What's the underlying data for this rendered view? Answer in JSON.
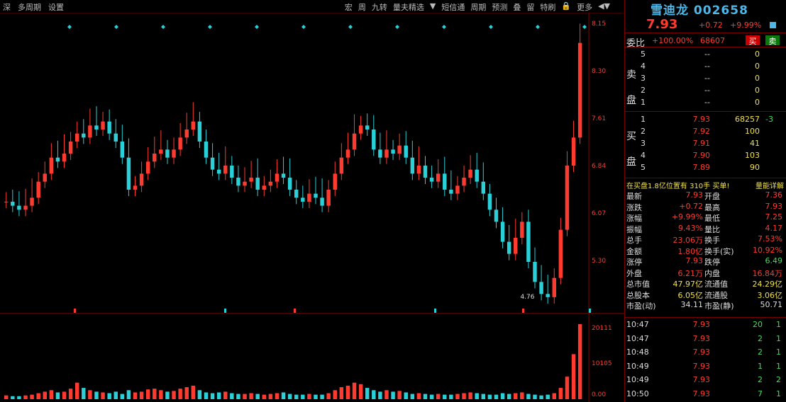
{
  "toolbar": {
    "left": [
      "深",
      "多周期",
      "设置"
    ],
    "right": [
      "宏",
      "周",
      "九转",
      "量夫精选",
      "▼",
      "短信通",
      "周期",
      "预测",
      "叠",
      "留",
      "特刷",
      "🔒",
      "更多",
      "◀▼"
    ]
  },
  "chart_data": {
    "type": "line",
    "price_axis_ticks": [
      "8.15",
      "8.30",
      "7.61",
      "6.84",
      "6.07",
      "5.30"
    ],
    "volume_axis_ticks": [
      "20111",
      "10105",
      "0.00"
    ],
    "low_annotation": "4.76",
    "ylim": [
      4.6,
      8.2
    ],
    "closes": [
      5.95,
      5.9,
      5.85,
      5.9,
      6.0,
      6.2,
      6.3,
      6.5,
      6.45,
      6.55,
      6.7,
      6.8,
      6.75,
      6.9,
      6.85,
      6.95,
      6.8,
      6.7,
      6.5,
      6.1,
      6.15,
      6.3,
      6.45,
      6.55,
      6.6,
      6.5,
      6.6,
      6.75,
      6.85,
      6.95,
      6.7,
      6.5,
      6.35,
      6.3,
      6.4,
      6.25,
      6.15,
      6.2,
      6.25,
      6.1,
      6.15,
      6.2,
      6.3,
      6.25,
      6.1,
      6.0,
      5.95,
      6.05,
      6.0,
      5.9,
      6.1,
      6.3,
      6.5,
      6.6,
      6.8,
      6.9,
      6.85,
      6.6,
      6.5,
      6.6,
      6.55,
      6.65,
      6.5,
      6.3,
      6.4,
      6.25,
      6.2,
      6.3,
      6.1,
      6.05,
      6.15,
      6.25,
      6.35,
      6.2,
      6.05,
      5.85,
      5.7,
      5.45,
      5.3,
      5.5,
      5.7,
      5.2,
      4.95,
      4.8,
      4.76,
      5.0,
      5.6,
      6.4,
      6.75,
      7.93
    ],
    "volume": [
      5,
      4,
      4,
      5,
      6,
      8,
      10,
      12,
      9,
      10,
      14,
      22,
      15,
      12,
      10,
      9,
      8,
      10,
      7,
      12,
      9,
      10,
      13,
      14,
      12,
      10,
      11,
      14,
      16,
      18,
      12,
      9,
      8,
      9,
      10,
      8,
      7,
      7,
      8,
      7,
      6,
      7,
      8,
      9,
      7,
      6,
      6,
      7,
      6,
      6,
      8,
      12,
      16,
      18,
      22,
      20,
      15,
      12,
      10,
      12,
      10,
      11,
      9,
      7,
      8,
      7,
      6,
      7,
      6,
      6,
      7,
      8,
      9,
      8,
      7,
      6,
      6,
      8,
      7,
      8,
      9,
      7,
      6,
      5,
      6,
      8,
      15,
      30,
      60,
      100
    ],
    "signal_markers_count": 12
  },
  "stock": {
    "name": "雪迪龙",
    "code": "002658",
    "price": "7.93",
    "change": "+0.72",
    "change_pct": "+9.99%"
  },
  "ratio": {
    "label": "委比",
    "pct": "+100.00%",
    "volume": "68607",
    "buy_label": "买",
    "sell_label": "卖"
  },
  "sell_side_label": "卖盘",
  "buy_side_label": "买盘",
  "asks": [
    {
      "level": "5",
      "price": "--",
      "vol": "0"
    },
    {
      "level": "4",
      "price": "--",
      "vol": "0"
    },
    {
      "level": "3",
      "price": "--",
      "vol": "0"
    },
    {
      "level": "2",
      "price": "--",
      "vol": "0"
    },
    {
      "level": "1",
      "price": "--",
      "vol": "0"
    }
  ],
  "bids": [
    {
      "level": "1",
      "price": "7.93",
      "vol": "68257",
      "delta": "-3"
    },
    {
      "level": "2",
      "price": "7.92",
      "vol": "100",
      "delta": ""
    },
    {
      "level": "3",
      "price": "7.91",
      "vol": "41",
      "delta": ""
    },
    {
      "level": "4",
      "price": "7.90",
      "vol": "103",
      "delta": ""
    },
    {
      "level": "5",
      "price": "7.89",
      "vol": "90",
      "delta": ""
    }
  ],
  "note": {
    "left": "在买盘1.8亿位置有 310手 买单!",
    "right": "量能详解"
  },
  "stats": [
    {
      "k1": "最新",
      "v1": "7.93",
      "k2": "开盘",
      "v2": "7.36"
    },
    {
      "k1": "涨跌",
      "v1": "+0.72",
      "k2": "最高",
      "v2": "7.93"
    },
    {
      "k1": "涨幅",
      "v1": "+9.99%",
      "k2": "最低",
      "v2": "7.25"
    },
    {
      "k1": "振幅",
      "v1": "9.43%",
      "k2": "量比",
      "v2": "4.17"
    },
    {
      "k1": "总手",
      "v1": "23.06万",
      "k2": "换手",
      "v2": "7.53%"
    },
    {
      "k1": "金额",
      "v1": "1.80亿",
      "k2": "换手(实)",
      "v2": "10.92%"
    },
    {
      "k1": "涨停",
      "v1": "7.93",
      "k2": "跌停",
      "v2": "6.49"
    },
    {
      "k1": "外盘",
      "v1": "6.21万",
      "k2": "内盘",
      "v2": "16.84万"
    },
    {
      "k1": "总市值",
      "v1": "47.97亿",
      "k2": "流通值",
      "v2": "24.29亿"
    },
    {
      "k1": "总股本",
      "v1": "6.05亿",
      "k2": "流通股",
      "v2": "3.06亿"
    },
    {
      "k1": "市盈(动)",
      "v1": "34.11",
      "k2": "市盈(静)",
      "v2": "50.71"
    }
  ],
  "ticks": [
    {
      "t": "10:47",
      "p": "7.93",
      "v": "20",
      "n": "1"
    },
    {
      "t": "10:47",
      "p": "7.93",
      "v": "2",
      "n": "1"
    },
    {
      "t": "10:48",
      "p": "7.93",
      "v": "2",
      "n": "1"
    },
    {
      "t": "10:49",
      "p": "7.93",
      "v": "1",
      "n": "1"
    },
    {
      "t": "10:49",
      "p": "7.93",
      "v": "2",
      "n": "2"
    },
    {
      "t": "10:50",
      "p": "7.93",
      "v": "7",
      "n": "1"
    }
  ],
  "colors": {
    "up": "#ff3b30",
    "down": "#2ad0d8",
    "accent": "#4fb7e8"
  }
}
